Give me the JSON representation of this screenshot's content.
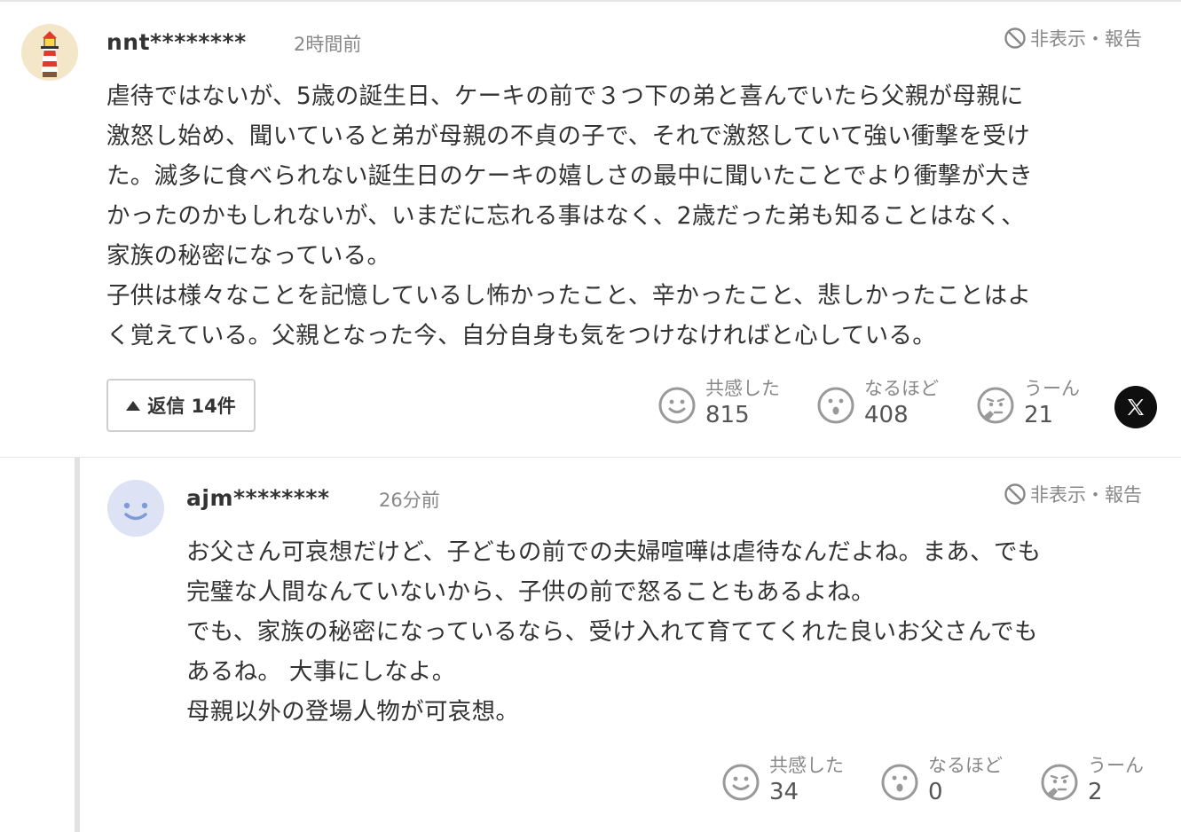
{
  "comments": [
    {
      "user": "nnt********",
      "time": "2時間前",
      "hide_label": "非表示・報告",
      "body": "虐待ではないが、5歳の誕生日、ケーキの前で３つ下の弟と喜んでいたら父親が母親に\n激怒し始め、聞いていると弟が母親の不貞の子で、それで激怒していて強い衝撃を受け\nた。滅多に食べられない誕生日のケーキの嬉しさの最中に聞いたことでより衝撃が大き\nかったのかもしれないが、いまだに忘れる事はなく、2歳だった弟も知ることはなく、\n家族の秘密になっている。\n子供は様々なことを記憶しているし怖かったこと、辛かったこと、悲しかったことはよ\nく覚えている。父親となった今、自分自身も気をつけなければと心している。",
      "reply_label": "返信 14件",
      "reactions": [
        {
          "label": "共感した",
          "count": "815",
          "icon": "smile-icon"
        },
        {
          "label": "なるほど",
          "count": "408",
          "icon": "surprised-icon"
        },
        {
          "label": "うーん",
          "count": "21",
          "icon": "thinking-icon"
        }
      ],
      "share_icon": "x-logo-icon"
    },
    {
      "user": "ajm********",
      "time": "26分前",
      "hide_label": "非表示・報告",
      "body": "お父さん可哀想だけど、子どもの前での夫婦喧嘩は虐待なんだよね。まあ、でも\n完璧な人間なんていないから、子供の前で怒ることもあるよね。\nでも、家族の秘密になっているなら、受け入れて育ててくれた良いお父さんでも\nあるね。 大事にしなよ。\n母親以外の登場人物が可哀想。",
      "reactions": [
        {
          "label": "共感した",
          "count": "34",
          "icon": "smile-icon"
        },
        {
          "label": "なるほど",
          "count": "0",
          "icon": "surprised-icon"
        },
        {
          "label": "うーん",
          "count": "2",
          "icon": "thinking-icon"
        }
      ]
    }
  ]
}
